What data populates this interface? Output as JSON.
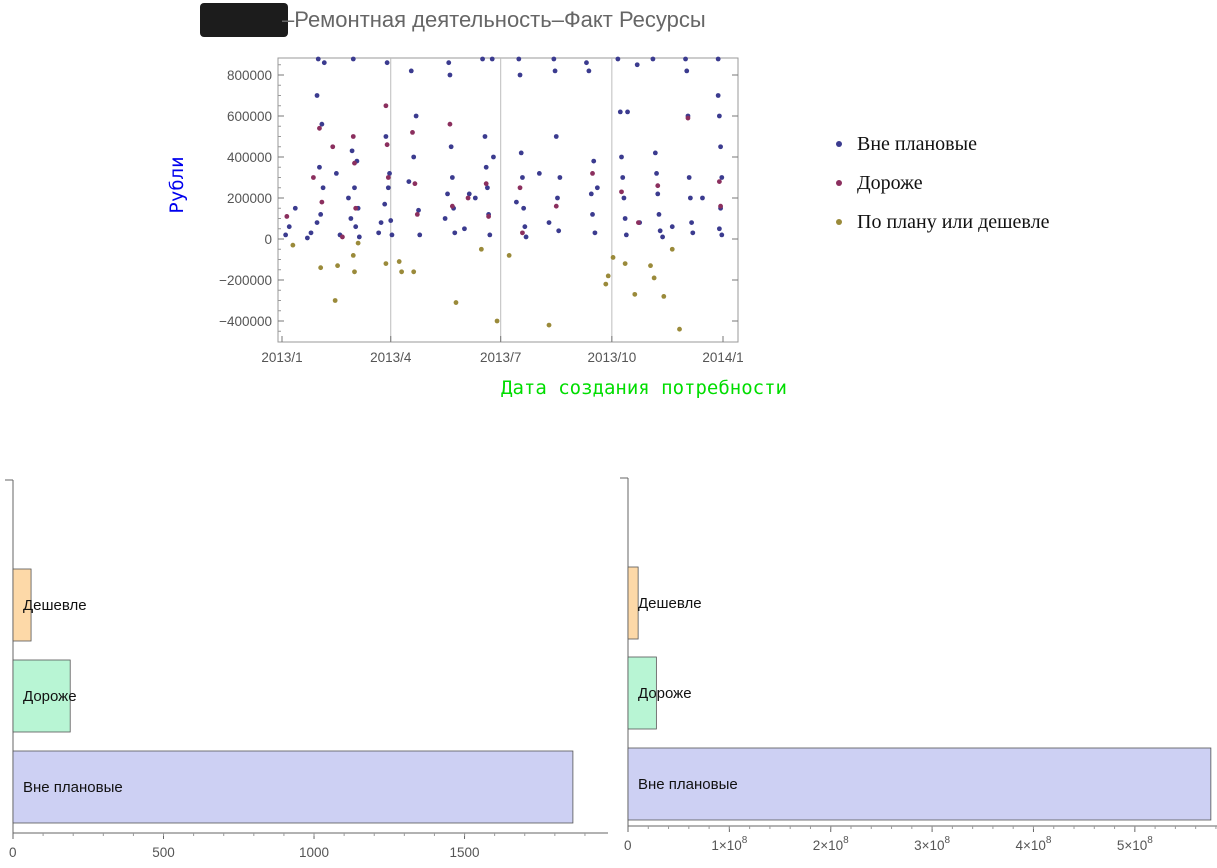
{
  "chart_data": [
    {
      "type": "scatter",
      "title": "–Ремонтная деятельность–Факт Ресурсы",
      "xlabel": "Дата создания потребности",
      "ylabel": "Рубли",
      "x_ticks": [
        "2013/1",
        "2013/4",
        "2013/7",
        "2013/10",
        "2014/1"
      ],
      "y_ticks": [
        -400000,
        -200000,
        0,
        200000,
        400000,
        600000,
        800000
      ],
      "y_tick_labels": [
        "−400000",
        "−200000",
        "0",
        "200000",
        "400000",
        "600000",
        "800000"
      ],
      "xlim": [
        "2013-01-01",
        "2014-01-01"
      ],
      "ylim": [
        -500000,
        880000
      ],
      "legend": "right",
      "series": [
        {
          "name": "Вне плановые",
          "color": "#3b3b8f"
        },
        {
          "name": "Дороже",
          "color": "#8b2f5e"
        },
        {
          "name": "По плану или дешевле",
          "color": "#9a8a3a"
        }
      ],
      "points": {
        "Вне плановые": [
          [
            "2013-01-04",
            20000
          ],
          [
            "2013-01-07",
            60000
          ],
          [
            "2013-01-12",
            150000
          ],
          [
            "2013-01-22",
            5000
          ],
          [
            "2013-01-25",
            30000
          ],
          [
            "2013-01-30",
            80000
          ],
          [
            "2013-01-30",
            700000
          ],
          [
            "2013-01-31",
            880000
          ],
          [
            "2013-02-01",
            350000
          ],
          [
            "2013-02-02",
            120000
          ],
          [
            "2013-02-03",
            560000
          ],
          [
            "2013-02-04",
            250000
          ],
          [
            "2013-02-05",
            860000
          ],
          [
            "2013-02-15",
            320000
          ],
          [
            "2013-02-18",
            20000
          ],
          [
            "2013-02-25",
            200000
          ],
          [
            "2013-02-27",
            100000
          ],
          [
            "2013-02-28",
            430000
          ],
          [
            "2013-03-01",
            880000
          ],
          [
            "2013-03-02",
            250000
          ],
          [
            "2013-03-03",
            60000
          ],
          [
            "2013-03-04",
            380000
          ],
          [
            "2013-03-05",
            150000
          ],
          [
            "2013-03-06",
            10000
          ],
          [
            "2013-03-22",
            30000
          ],
          [
            "2013-03-24",
            80000
          ],
          [
            "2013-03-27",
            170000
          ],
          [
            "2013-03-28",
            500000
          ],
          [
            "2013-03-29",
            860000
          ],
          [
            "2013-03-30",
            250000
          ],
          [
            "2013-03-31",
            320000
          ],
          [
            "2013-04-01",
            90000
          ],
          [
            "2013-04-02",
            20000
          ],
          [
            "2013-04-16",
            280000
          ],
          [
            "2013-04-18",
            820000
          ],
          [
            "2013-04-20",
            400000
          ],
          [
            "2013-04-22",
            600000
          ],
          [
            "2013-04-24",
            140000
          ],
          [
            "2013-04-25",
            20000
          ],
          [
            "2013-05-16",
            100000
          ],
          [
            "2013-05-18",
            220000
          ],
          [
            "2013-05-19",
            860000
          ],
          [
            "2013-05-20",
            800000
          ],
          [
            "2013-05-21",
            450000
          ],
          [
            "2013-05-22",
            300000
          ],
          [
            "2013-05-23",
            150000
          ],
          [
            "2013-05-24",
            30000
          ],
          [
            "2013-06-01",
            50000
          ],
          [
            "2013-06-05",
            220000
          ],
          [
            "2013-06-10",
            200000
          ],
          [
            "2013-06-16",
            880000
          ],
          [
            "2013-06-18",
            500000
          ],
          [
            "2013-06-19",
            350000
          ],
          [
            "2013-06-20",
            250000
          ],
          [
            "2013-06-21",
            120000
          ],
          [
            "2013-06-22",
            20000
          ],
          [
            "2013-06-24",
            880000
          ],
          [
            "2013-06-25",
            400000
          ],
          [
            "2013-07-14",
            180000
          ],
          [
            "2013-07-16",
            880000
          ],
          [
            "2013-07-17",
            800000
          ],
          [
            "2013-07-18",
            420000
          ],
          [
            "2013-07-19",
            300000
          ],
          [
            "2013-07-20",
            150000
          ],
          [
            "2013-07-21",
            60000
          ],
          [
            "2013-07-22",
            10000
          ],
          [
            "2013-08-02",
            320000
          ],
          [
            "2013-08-10",
            80000
          ],
          [
            "2013-08-14",
            880000
          ],
          [
            "2013-08-15",
            820000
          ],
          [
            "2013-08-16",
            500000
          ],
          [
            "2013-08-17",
            200000
          ],
          [
            "2013-08-18",
            40000
          ],
          [
            "2013-08-19",
            300000
          ],
          [
            "2013-09-10",
            860000
          ],
          [
            "2013-09-12",
            820000
          ],
          [
            "2013-09-14",
            220000
          ],
          [
            "2013-09-15",
            120000
          ],
          [
            "2013-09-16",
            380000
          ],
          [
            "2013-09-17",
            30000
          ],
          [
            "2013-09-19",
            250000
          ],
          [
            "2013-10-06",
            880000
          ],
          [
            "2013-10-08",
            620000
          ],
          [
            "2013-10-09",
            400000
          ],
          [
            "2013-10-10",
            300000
          ],
          [
            "2013-10-11",
            200000
          ],
          [
            "2013-10-12",
            100000
          ],
          [
            "2013-10-13",
            20000
          ],
          [
            "2013-10-14",
            620000
          ],
          [
            "2013-10-22",
            850000
          ],
          [
            "2013-10-24",
            80000
          ],
          [
            "2013-11-04",
            880000
          ],
          [
            "2013-11-06",
            420000
          ],
          [
            "2013-11-07",
            320000
          ],
          [
            "2013-11-08",
            220000
          ],
          [
            "2013-11-09",
            120000
          ],
          [
            "2013-11-10",
            40000
          ],
          [
            "2013-11-12",
            10000
          ],
          [
            "2013-11-20",
            60000
          ],
          [
            "2013-12-01",
            880000
          ],
          [
            "2013-12-02",
            820000
          ],
          [
            "2013-12-03",
            600000
          ],
          [
            "2013-12-04",
            300000
          ],
          [
            "2013-12-05",
            200000
          ],
          [
            "2013-12-06",
            80000
          ],
          [
            "2013-12-07",
            30000
          ],
          [
            "2013-12-15",
            200000
          ],
          [
            "2013-12-28",
            880000
          ],
          [
            "2013-12-29",
            600000
          ],
          [
            "2013-12-30",
            450000
          ],
          [
            "2013-12-31",
            300000
          ],
          [
            "2013-12-30",
            150000
          ],
          [
            "2013-12-29",
            50000
          ],
          [
            "2013-12-28",
            700000
          ],
          [
            "2013-12-31",
            20000
          ]
        ],
        "Дороже": [
          [
            "2013-01-05",
            110000
          ],
          [
            "2013-01-27",
            300000
          ],
          [
            "2013-02-01",
            540000
          ],
          [
            "2013-02-03",
            180000
          ],
          [
            "2013-02-12",
            450000
          ],
          [
            "2013-02-20",
            10000
          ],
          [
            "2013-03-01",
            500000
          ],
          [
            "2013-03-02",
            370000
          ],
          [
            "2013-03-03",
            150000
          ],
          [
            "2013-03-28",
            650000
          ],
          [
            "2013-03-29",
            460000
          ],
          [
            "2013-03-30",
            300000
          ],
          [
            "2013-04-19",
            520000
          ],
          [
            "2013-04-21",
            270000
          ],
          [
            "2013-04-23",
            120000
          ],
          [
            "2013-05-20",
            560000
          ],
          [
            "2013-05-22",
            160000
          ],
          [
            "2013-06-04",
            200000
          ],
          [
            "2013-06-19",
            270000
          ],
          [
            "2013-06-21",
            110000
          ],
          [
            "2013-07-17",
            250000
          ],
          [
            "2013-07-19",
            30000
          ],
          [
            "2013-08-16",
            160000
          ],
          [
            "2013-09-15",
            320000
          ],
          [
            "2013-10-09",
            230000
          ],
          [
            "2013-10-23",
            80000
          ],
          [
            "2013-11-08",
            260000
          ],
          [
            "2013-12-03",
            590000
          ],
          [
            "2013-12-29",
            280000
          ],
          [
            "2013-12-30",
            160000
          ]
        ],
        "По плану или дешевле": [
          [
            "2013-01-10",
            -30000
          ],
          [
            "2013-02-02",
            -140000
          ],
          [
            "2013-02-14",
            -300000
          ],
          [
            "2013-02-16",
            -130000
          ],
          [
            "2013-03-01",
            -80000
          ],
          [
            "2013-03-02",
            -160000
          ],
          [
            "2013-03-05",
            -20000
          ],
          [
            "2013-03-28",
            -120000
          ],
          [
            "2013-04-08",
            -110000
          ],
          [
            "2013-04-10",
            -160000
          ],
          [
            "2013-04-20",
            -160000
          ],
          [
            "2013-05-25",
            -310000
          ],
          [
            "2013-06-15",
            -50000
          ],
          [
            "2013-06-28",
            -400000
          ],
          [
            "2013-07-08",
            -80000
          ],
          [
            "2013-08-10",
            -420000
          ],
          [
            "2013-09-26",
            -220000
          ],
          [
            "2013-09-28",
            -180000
          ],
          [
            "2013-10-02",
            -90000
          ],
          [
            "2013-10-12",
            -120000
          ],
          [
            "2013-10-20",
            -270000
          ],
          [
            "2013-11-02",
            -130000
          ],
          [
            "2013-11-05",
            -190000
          ],
          [
            "2013-11-13",
            -280000
          ],
          [
            "2013-11-26",
            -440000
          ],
          [
            "2013-11-20",
            -50000
          ]
        ]
      }
    },
    {
      "type": "bar",
      "orientation": "horizontal",
      "categories": [
        "Вне плановые",
        "Дороже",
        "Дешевле"
      ],
      "values": [
        1860,
        190,
        60
      ],
      "colors": [
        "#cdd0f3",
        "#b8f5d4",
        "#fdd9a8"
      ],
      "x_ticks": [
        0,
        500,
        1000,
        1500
      ],
      "x_tick_labels": [
        "0",
        "500",
        "1000",
        "1500"
      ],
      "xlim": [
        0,
        1950
      ]
    },
    {
      "type": "bar",
      "orientation": "horizontal",
      "categories": [
        "Вне плановые",
        "Дороже",
        "Дешевле"
      ],
      "values": [
        575000000,
        28000000,
        10000000
      ],
      "colors": [
        "#cdd0f3",
        "#b8f5d4",
        "#fdd9a8"
      ],
      "x_ticks": [
        0,
        100000000,
        200000000,
        300000000,
        400000000,
        500000000
      ],
      "x_tick_labels": [
        "0",
        "1×10",
        "2×10",
        "3×10",
        "4×10",
        "5×10"
      ],
      "x_tick_exponent": "8",
      "xlim": [
        0,
        585000000
      ]
    }
  ]
}
